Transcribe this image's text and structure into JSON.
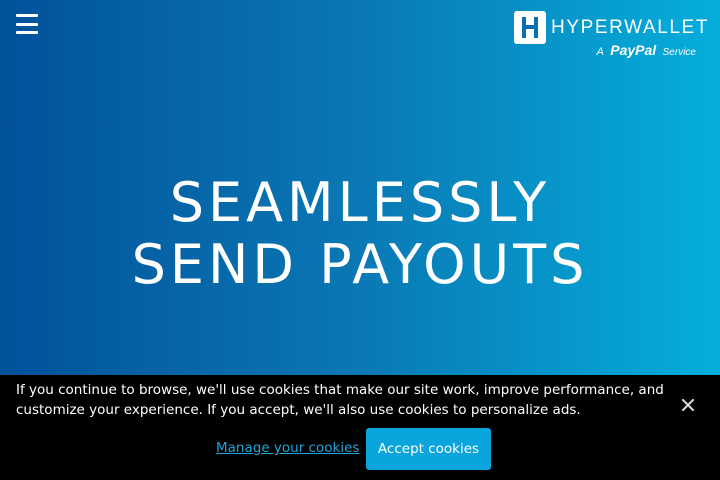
{
  "header": {
    "menu_icon": "hamburger-menu-icon",
    "logo": {
      "wordmark": "HYPERWALLET",
      "tagline_prefix": "A",
      "tagline_brand": "PayPal",
      "tagline_suffix": "Service"
    }
  },
  "hero": {
    "line1": "SEAMLESSLY",
    "line2": "SEND PAYOUTS"
  },
  "cookie_banner": {
    "message": "If you continue to browse, we'll use cookies that make our site work, improve performance, and customize your experience. If you accept, we'll also use cookies to personalize ads.",
    "manage_label": "Manage your cookies",
    "accept_label": "Accept cookies",
    "close_icon": "close-icon"
  },
  "colors": {
    "gradient_start": "#02519a",
    "gradient_end": "#05aedc",
    "accent": "#0aa5dc",
    "banner_bg": "#000000"
  }
}
